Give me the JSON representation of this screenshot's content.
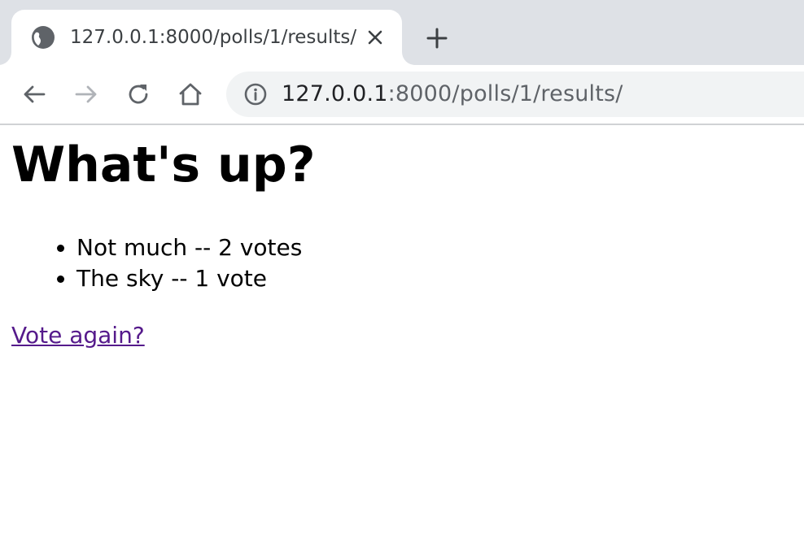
{
  "tab": {
    "title": "127.0.0.1:8000/polls/1/results/",
    "favicon": "globe-icon",
    "close_icon": "close-icon"
  },
  "new_tab_icon": "plus-icon",
  "toolbar": {
    "back_icon": "arrow-left-icon",
    "forward_icon": "arrow-right-icon",
    "reload_icon": "reload-icon",
    "home_icon": "home-icon",
    "info_icon": "info-icon",
    "url_host": "127.0.0.1",
    "url_rest": ":8000/polls/1/results/"
  },
  "page": {
    "question": "What's up?",
    "choices": [
      {
        "text": "Not much -- 2 votes"
      },
      {
        "text": "The sky -- 1 vote"
      }
    ],
    "vote_again_link": "Vote again?",
    "link_color": "#551a8b"
  },
  "colors": {
    "tabstrip_bg": "#dee1e6",
    "omnibox_bg": "#f1f3f4",
    "icon_dark": "#5f6368",
    "icon_disabled": "#b0b3b8"
  }
}
